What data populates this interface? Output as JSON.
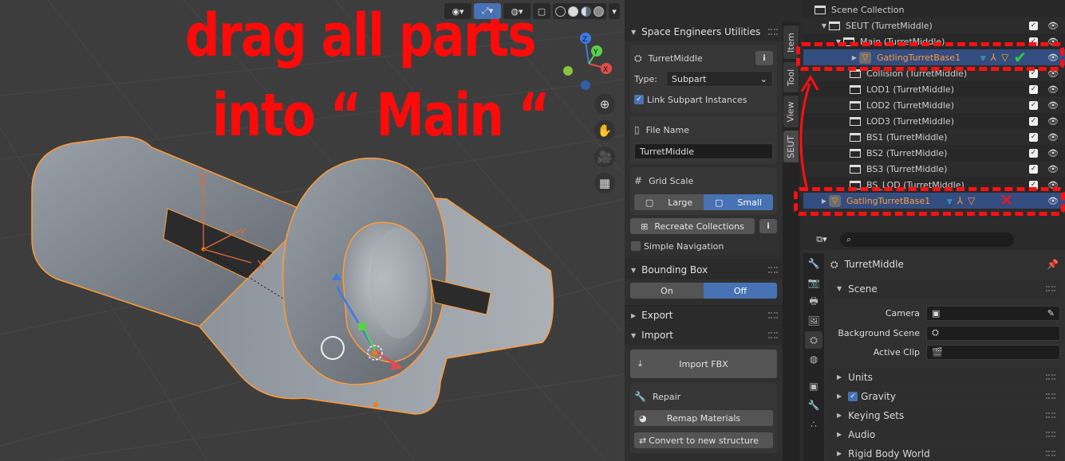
{
  "overlay": {
    "line1": "drag all parts",
    "line2": "into “ Main “",
    "color": "#ff0a0a"
  },
  "viewport": {
    "gizmo_labels": {
      "z": "Z",
      "x": "X",
      "y": "Y"
    },
    "nav_icons": [
      "zoom-icon",
      "hand-pan-icon",
      "camera-icon",
      "grid-ortho-icon"
    ]
  },
  "npanel": {
    "title": "Space Engineers Utilities",
    "object_name": "TurretMiddle",
    "type_label": "Type:",
    "type_value": "Subpart",
    "link_subpart": "Link Subpart Instances",
    "file_name_label": "File Name",
    "file_name_value": "TurretMiddle",
    "grid_scale_label": "Grid Scale",
    "grid_large": "Large",
    "grid_small": "Small",
    "recreate_collections": "Recreate Collections",
    "simple_navigation": "Simple Navigation",
    "bounding_box": "Bounding Box",
    "bb_on": "On",
    "bb_off": "Off",
    "export": "Export",
    "import": "Import",
    "import_fbx": "Import FBX",
    "repair": "Repair",
    "remap_materials": "Remap Materials",
    "convert_structure": "Convert to new structure"
  },
  "tabs": [
    "Item",
    "Tool",
    "View",
    "SEUT"
  ],
  "outliner": {
    "rows": [
      {
        "label": "Scene Collection"
      },
      {
        "label": "SEUT (TurretMiddle)"
      },
      {
        "label": "Main (TurretMiddle)"
      },
      {
        "label": "GatlingTurretBase1"
      },
      {
        "label": "Collision (TurretMiddle)"
      },
      {
        "label": "LOD1 (TurretMiddle)"
      },
      {
        "label": "LOD2 (TurretMiddle)"
      },
      {
        "label": "LOD3 (TurretMiddle)"
      },
      {
        "label": "BS1 (TurretMiddle)"
      },
      {
        "label": "BS2 (TurretMiddle)"
      },
      {
        "label": "BS3 (TurretMiddle)"
      },
      {
        "label": "BS_LOD (TurretMiddle)"
      },
      {
        "label": "GatlingTurretBase1"
      }
    ]
  },
  "properties": {
    "object_name": "TurretMiddle",
    "scene_header": "Scene",
    "camera_label": "Camera",
    "background_label": "Background Scene",
    "active_clip_label": "Active Clip",
    "units": "Units",
    "gravity": "Gravity",
    "keying_sets": "Keying Sets",
    "audio": "Audio",
    "rigid_body_world": "Rigid Body World"
  },
  "colors": {
    "accent": "#4772b3",
    "selected_text": "#ff9b37",
    "annotation_red": "#ff1010",
    "check_green": "#2ecc40"
  }
}
